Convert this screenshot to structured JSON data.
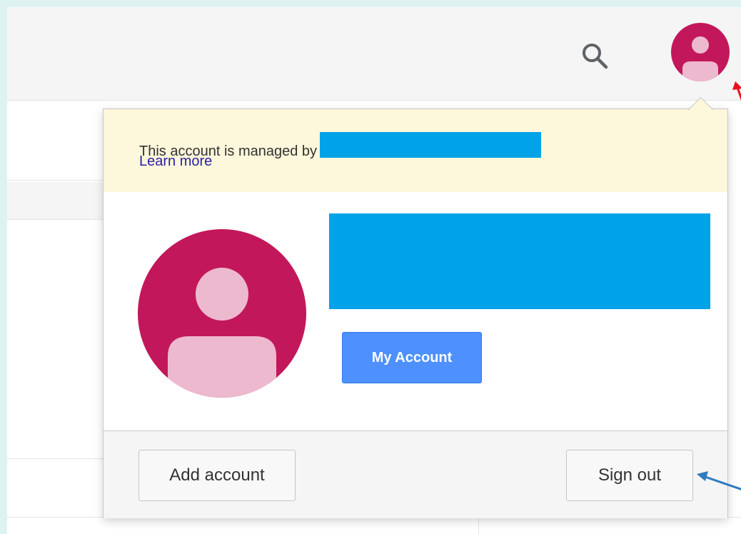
{
  "header": {
    "search_icon": "search-icon",
    "avatar_icon": "account-avatar-icon"
  },
  "account_popup": {
    "managed_text": "This account is managed by",
    "learn_more_label": "Learn more",
    "my_account_label": "My Account",
    "add_account_label": "Add account",
    "sign_out_label": "Sign out"
  },
  "colors": {
    "avatar_background": "#c2185b",
    "avatar_figure": "#edb9cf",
    "redaction": "#00a2e8",
    "primary_button": "#4d90fe",
    "banner_background": "#fdf7db",
    "link": "#2a1fa5",
    "annotation_red": "#e8101b",
    "annotation_blue": "#2e7bbf"
  }
}
